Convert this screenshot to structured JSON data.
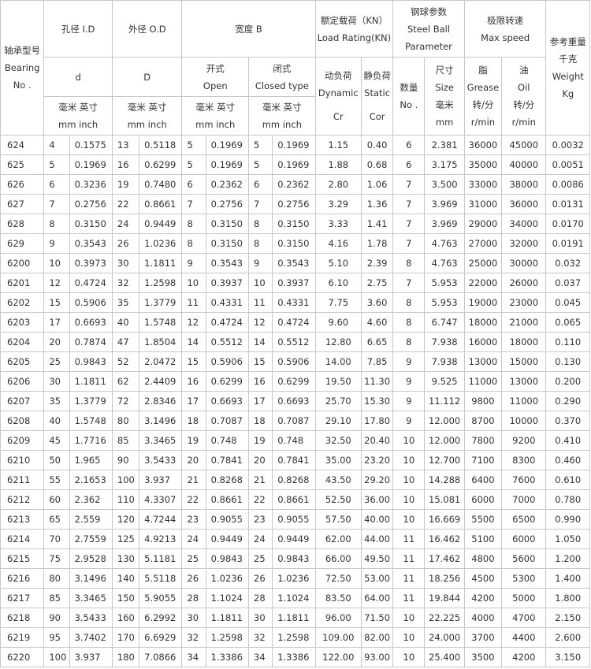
{
  "header": {
    "model": [
      "轴承型号",
      "Bearing",
      "No ."
    ],
    "bore": "孔径 I.D",
    "bore_sym": "d",
    "outer": "外径 O.D",
    "outer_sym": "D",
    "width": "宽度 B",
    "open": [
      "开式",
      "Open"
    ],
    "closed": [
      "闭式",
      "Closed type"
    ],
    "load": [
      "额定载荷（KN）",
      "Load Rating(KN)"
    ],
    "dynamic": [
      "动负荷",
      "Dynamic",
      "Cr"
    ],
    "static": [
      "静负荷",
      "Static",
      "Cor"
    ],
    "ball": [
      "钢球参数",
      "Steel Ball",
      "Parameter"
    ],
    "ball_num": [
      "数量",
      "No ."
    ],
    "ball_size": [
      "尺寸",
      "Size",
      "毫米",
      "mm"
    ],
    "speed": [
      "极限转速",
      "Max speed"
    ],
    "grease": [
      "脂",
      "Grease",
      "转/分",
      "r/min"
    ],
    "oil": [
      "油",
      "Oil",
      "转/分",
      "r/min"
    ],
    "weight": [
      "参考重量",
      "千克",
      "Weight",
      "Kg"
    ],
    "unit_mm_inch": [
      "毫米 英寸",
      "mm inch"
    ]
  },
  "rows": [
    [
      "624",
      "4",
      "0.1575",
      "13",
      "0.5118",
      "5",
      "0.1969",
      "5",
      "0.1969",
      "1.15",
      "0.40",
      "6",
      "2.381",
      "36000",
      "45000",
      "0.0032"
    ],
    [
      "625",
      "5",
      "0.1969",
      "16",
      "0.6299",
      "5",
      "0.1969",
      "5",
      "0.1969",
      "1.88",
      "0.68",
      "6",
      "3.175",
      "35000",
      "40000",
      "0.0051"
    ],
    [
      "626",
      "6",
      "0.3236",
      "19",
      "0.7480",
      "6",
      "0.2362",
      "6",
      "0.2362",
      "2.80",
      "1.06",
      "7",
      "3.500",
      "33000",
      "38000",
      "0.0086"
    ],
    [
      "627",
      "7",
      "0.2756",
      "22",
      "0.8661",
      "7",
      "0.2756",
      "7",
      "0.2756",
      "3.29",
      "1.36",
      "7",
      "3.969",
      "31000",
      "36000",
      "0.0131"
    ],
    [
      "628",
      "8",
      "0.3150",
      "24",
      "0.9449",
      "8",
      "0.3150",
      "8",
      "0.3150",
      "3.33",
      "1.41",
      "7",
      "3.969",
      "29000",
      "34000",
      "0.0170"
    ],
    [
      "629",
      "9",
      "0.3543",
      "26",
      "1.0236",
      "8",
      "0.3150",
      "8",
      "0.3150",
      "4.16",
      "1.78",
      "7",
      "4.763",
      "27000",
      "32000",
      "0.0191"
    ],
    [
      "6200",
      "10",
      "0.3973",
      "30",
      "1.1811",
      "9",
      "0.3543",
      "9",
      "0.3543",
      "5.10",
      "2.39",
      "8",
      "4.763",
      "25000",
      "30000",
      "0.032"
    ],
    [
      "6201",
      "12",
      "0.4724",
      "32",
      "1.2598",
      "10",
      "0.3937",
      "10",
      "0.3937",
      "6.10",
      "2.75",
      "7",
      "5.953",
      "22000",
      "26000",
      "0.037"
    ],
    [
      "6202",
      "15",
      "0.5906",
      "35",
      "1.3779",
      "11",
      "0.4331",
      "11",
      "0.4331",
      "7.75",
      "3.60",
      "8",
      "5.953",
      "19000",
      "23000",
      "0.045"
    ],
    [
      "6203",
      "17",
      "0.6693",
      "40",
      "1.5748",
      "12",
      "0.4724",
      "12",
      "0.4724",
      "9.60",
      "4.60",
      "8",
      "6.747",
      "18000",
      "21000",
      "0.065"
    ],
    [
      "6204",
      "20",
      "0.7874",
      "47",
      "1.8504",
      "14",
      "0.5512",
      "14",
      "0.5512",
      "12.80",
      "6.65",
      "8",
      "7.938",
      "16000",
      "18000",
      "0.110"
    ],
    [
      "6205",
      "25",
      "0.9843",
      "52",
      "2.0472",
      "15",
      "0.5906",
      "15",
      "0.5906",
      "14.00",
      "7.85",
      "9",
      "7.938",
      "13000",
      "15000",
      "0.130"
    ],
    [
      "6206",
      "30",
      "1.1811",
      "62",
      "2.4409",
      "16",
      "0.6299",
      "16",
      "0.6299",
      "19.50",
      "11.30",
      "9",
      "9.525",
      "11000",
      "13000",
      "0.200"
    ],
    [
      "6207",
      "35",
      "1.3779",
      "72",
      "2.8346",
      "17",
      "0.6693",
      "17",
      "0.6693",
      "25.70",
      "15.30",
      "9",
      "11.112",
      "9800",
      "11000",
      "0.290"
    ],
    [
      "6208",
      "40",
      "1.5748",
      "80",
      "3.1496",
      "18",
      "0.7087",
      "18",
      "0.7087",
      "29.10",
      "17.80",
      "9",
      "12.000",
      "8700",
      "10000",
      "0.370"
    ],
    [
      "6209",
      "45",
      "1.7716",
      "85",
      "3.3465",
      "19",
      "0.748",
      "19",
      "0.748",
      "32.50",
      "20.40",
      "10",
      "12.000",
      "7800",
      "9200",
      "0.410"
    ],
    [
      "6210",
      "50",
      "1.965",
      "90",
      "3.5433",
      "20",
      "0.7841",
      "20",
      "0.7841",
      "35.00",
      "23.20",
      "10",
      "12.700",
      "7100",
      "8300",
      "0.460"
    ],
    [
      "6211",
      "55",
      "2.1653",
      "100",
      "3.937",
      "21",
      "0.8268",
      "21",
      "0.8268",
      "43.50",
      "29.20",
      "10",
      "14.288",
      "6400",
      "7600",
      "0.610"
    ],
    [
      "6212",
      "60",
      "2.362",
      "110",
      "4.3307",
      "22",
      "0.8661",
      "22",
      "0.8661",
      "52.50",
      "36.00",
      "10",
      "15.081",
      "6000",
      "7000",
      "0.780"
    ],
    [
      "6213",
      "65",
      "2.559",
      "120",
      "4.7244",
      "23",
      "0.9055",
      "23",
      "0.9055",
      "57.50",
      "40.00",
      "10",
      "16.669",
      "5500",
      "6500",
      "0.990"
    ],
    [
      "6214",
      "70",
      "2.7559",
      "125",
      "4.9213",
      "24",
      "0.9449",
      "24",
      "0.9449",
      "62.00",
      "44.00",
      "11",
      "16.462",
      "5100",
      "6000",
      "1.050"
    ],
    [
      "6215",
      "75",
      "2.9528",
      "130",
      "5.1181",
      "25",
      "0.9843",
      "25",
      "0.9843",
      "66.00",
      "49.50",
      "11",
      "17.462",
      "4800",
      "5600",
      "1.200"
    ],
    [
      "6216",
      "80",
      "3.1496",
      "140",
      "5.5118",
      "26",
      "1.0236",
      "26",
      "1.0236",
      "72.50",
      "53.00",
      "11",
      "18.256",
      "4500",
      "5300",
      "1.400"
    ],
    [
      "6217",
      "85",
      "3.3465",
      "150",
      "5.9055",
      "28",
      "1.1024",
      "28",
      "1.1024",
      "83.50",
      "64.00",
      "11",
      "19.844",
      "4200",
      "5000",
      "1.800"
    ],
    [
      "6218",
      "90",
      "3.5433",
      "160",
      "6.2992",
      "30",
      "1.1811",
      "30",
      "1.1811",
      "96.00",
      "71.50",
      "10",
      "22.225",
      "4000",
      "4700",
      "2.150"
    ],
    [
      "6219",
      "95",
      "3.7402",
      "170",
      "6.6929",
      "32",
      "1.2598",
      "32",
      "1.2598",
      "109.00",
      "82.00",
      "10",
      "24.000",
      "3700",
      "4400",
      "2.600"
    ],
    [
      "6220",
      "100",
      "3.937",
      "180",
      "7.0866",
      "34",
      "1.3386",
      "34",
      "1.3386",
      "122.00",
      "93.00",
      "10",
      "25.400",
      "3500",
      "4200",
      "3.150"
    ]
  ]
}
